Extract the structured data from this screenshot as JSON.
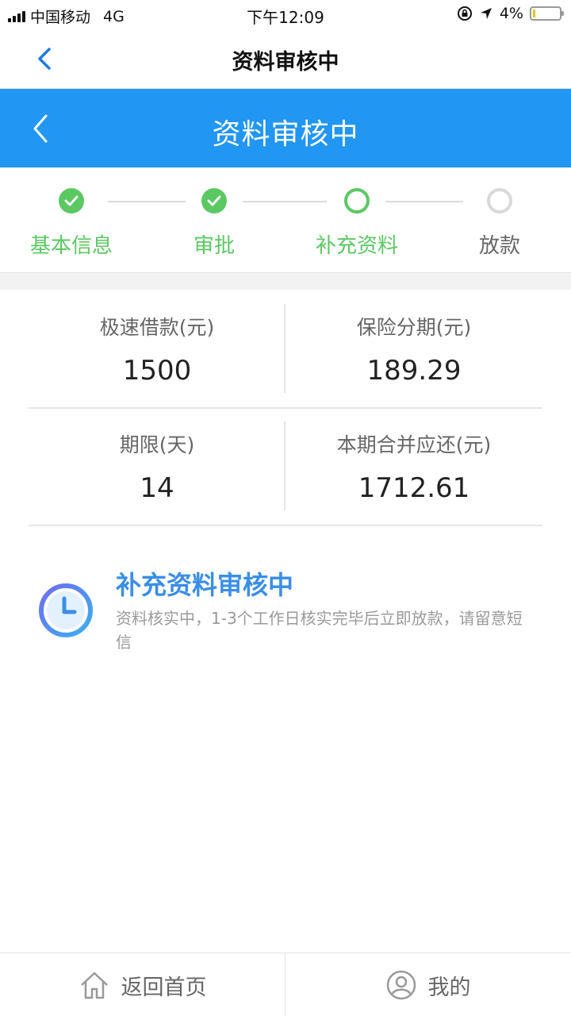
{
  "status_bar": {
    "carrier": "中国移动",
    "network": "4G",
    "time": "下午12:09",
    "battery": "4%",
    "battery_level": 0.04
  },
  "nav_white": {
    "title": "资料审核中"
  },
  "nav_blue": {
    "title": "资料审核中"
  },
  "steps": [
    {
      "label": "基本信息",
      "state": "done"
    },
    {
      "label": "审批",
      "state": "done"
    },
    {
      "label": "补充资料",
      "state": "current"
    },
    {
      "label": "放款",
      "state": "pending"
    }
  ],
  "info": {
    "loan_label": "极速借款(元)",
    "loan_value": "1500",
    "insurance_label": "保险分期(元)",
    "insurance_value": "189.29",
    "term_label": "期限(天)",
    "term_value": "14",
    "repay_label": "本期合并应还(元)",
    "repay_value": "1712.61"
  },
  "notice": {
    "title": "补充资料审核中",
    "desc": "资料核实中，1-3个工作日核实完毕后立即放款，请留意短信"
  },
  "bottom_bar": {
    "home_label": "返回首页",
    "mine_label": "我的"
  },
  "colors": {
    "brand_blue": "#2196f3",
    "step_green": "#5bc862",
    "notice_blue": "#3a8ee6"
  }
}
